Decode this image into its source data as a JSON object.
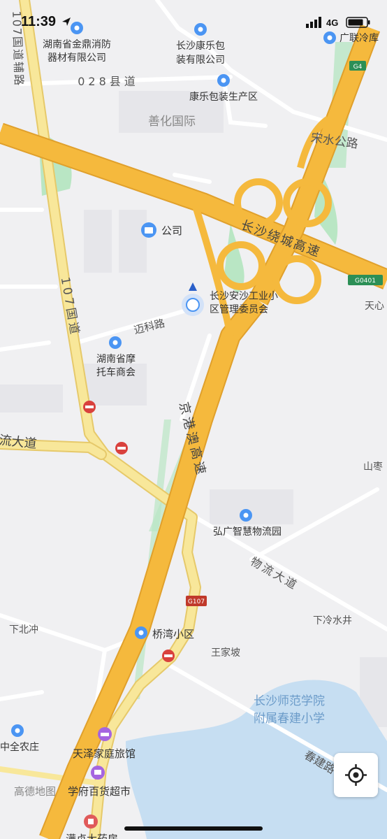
{
  "status_bar": {
    "time": "11:39",
    "network": "4G"
  },
  "map": {
    "road_labels": {
      "g107_vertical": "107国道",
      "g107_aux": "107国道辅路",
      "county_road": "028县道",
      "songshui": "宋水公路",
      "ring_expressway": "长沙绕城高速",
      "maike": "迈科路",
      "liu_dadao": "流大道",
      "jinggang": "京港澳高速",
      "wuliu": "物流大道",
      "chunjian": "春建路"
    },
    "shields": {
      "g4": "G4",
      "g0401": "G0401",
      "g107": "G107"
    },
    "pois": {
      "jinding_1": "湖南省金鼎消防",
      "jinding_2": "器材有限公司",
      "kangle_1": "长沙康乐包",
      "kangle_2": "装有限公司",
      "kangle_zone": "康乐包装生产区",
      "guanglian": "广联冷库",
      "shanhua": "善化国际",
      "company": "公司",
      "anshao_1": "长沙安沙工业小",
      "anshao_2": "区管理委员会",
      "motor_1": "湖南省摩",
      "motor_2": "托车商会",
      "hongguang": "弘广智慧物流园",
      "qiaowan": "桥湾小区",
      "wangjiapo": "王家坡",
      "xiabeichong": "下北冲",
      "xialengshuijing": "下冷水井",
      "normal_1": "长沙师范学院",
      "normal_2": "附属春建小学",
      "zhongquan": "中全农庄",
      "tianze": "天泽家庭旅馆",
      "xuefu": "学府百货超市",
      "pharmacy": "满贞大药房",
      "tianxin": "天心",
      "shanzao": "山枣"
    },
    "watermark": "高德地图"
  },
  "colors": {
    "background": "#f0f0f2",
    "expressway": "#f5b93d",
    "national_road": "#f8e79a",
    "green": "#b9e6c4",
    "water": "#c6def2",
    "poi_blue": "#4b95f3",
    "poi_purple": "#a565e0",
    "poi_red": "#e05a5a",
    "no_entry_red": "#d9413d"
  },
  "icons": {
    "locate": "locate-icon",
    "signal": "signal-icon",
    "battery": "battery-icon",
    "arrow": "location-arrow-icon"
  }
}
